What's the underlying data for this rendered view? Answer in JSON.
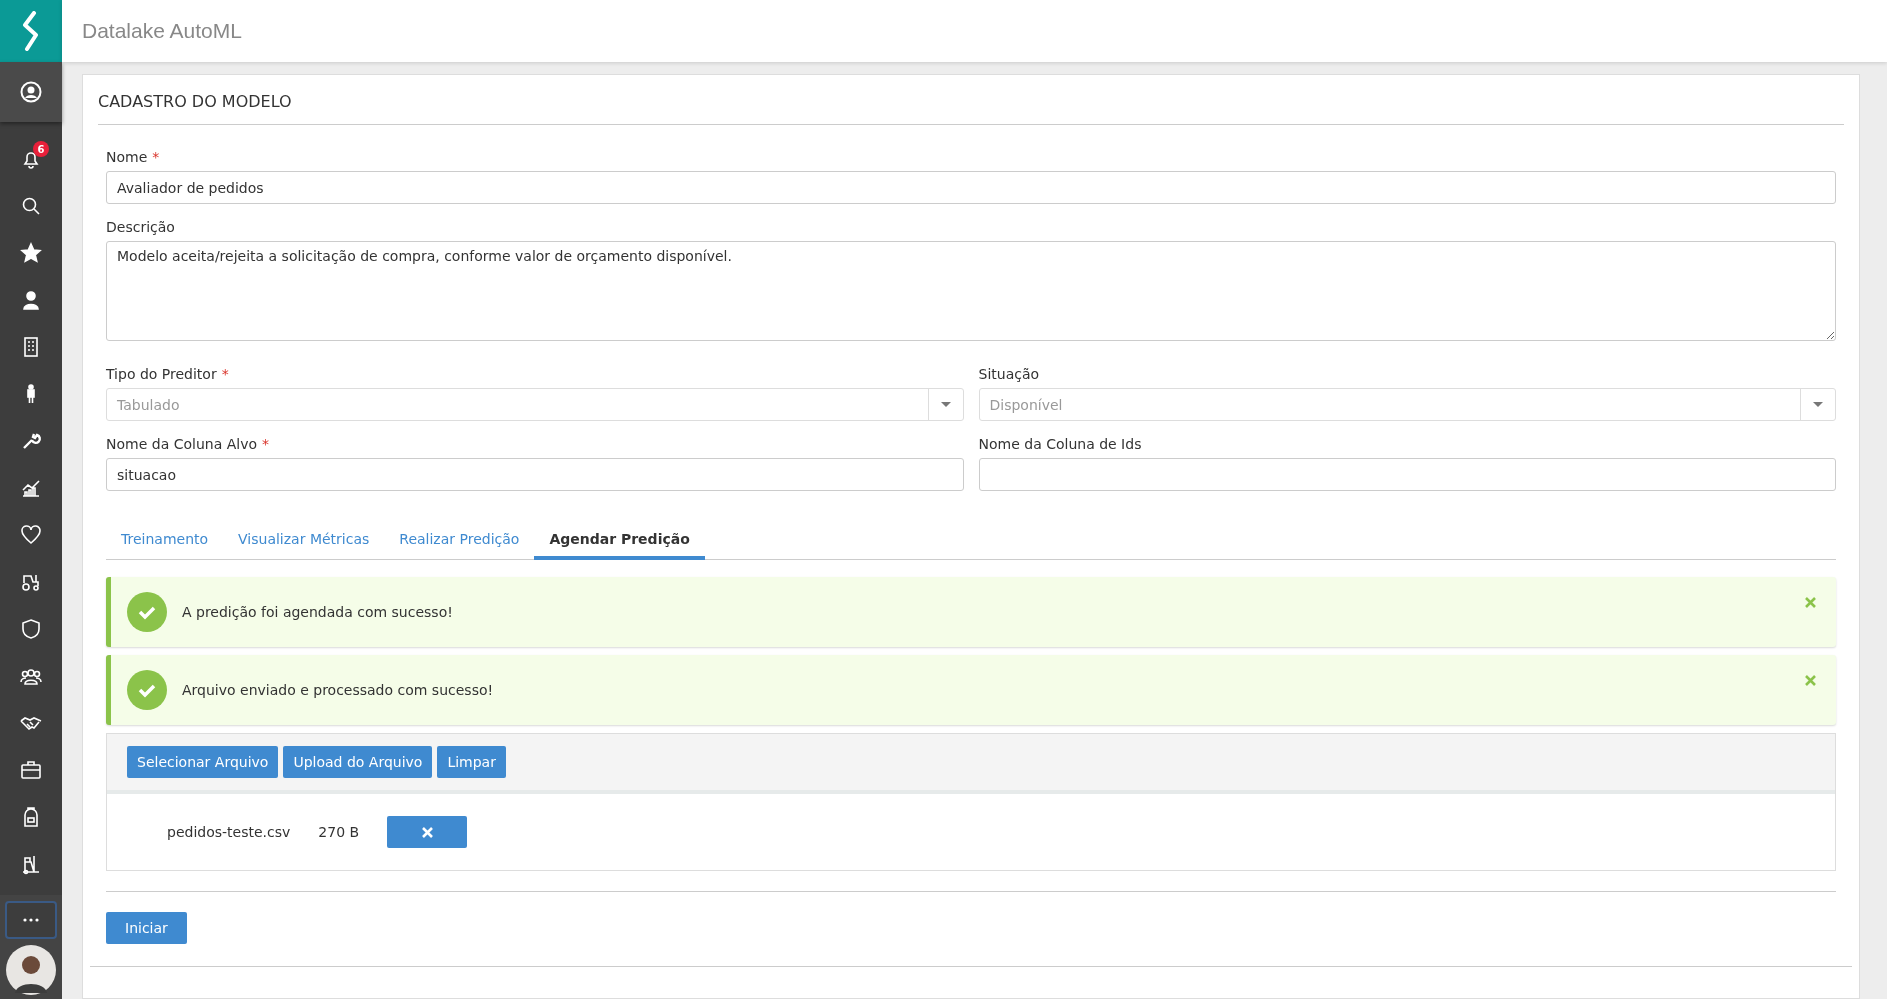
{
  "sidebar": {
    "notification_badge": "6"
  },
  "header": {
    "title": "Datalake AutoML"
  },
  "form": {
    "title": "CADASTRO DO MODELO",
    "name": {
      "label": "Nome",
      "required_mark": "*",
      "value": "Avaliador de pedidos"
    },
    "description": {
      "label": "Descrição",
      "value": "Modelo aceita/rejeita a solicitação de compra, conforme valor de orçamento disponível."
    },
    "fields": [
      {
        "kind": "select",
        "label": "Tipo do Preditor",
        "required_mark": "*",
        "placeholder": "Tabulado"
      },
      {
        "kind": "select",
        "label": "Situação",
        "placeholder": "Disponível"
      },
      {
        "kind": "text",
        "label": "Nome da Coluna Alvo",
        "required_mark": "*",
        "value": "situacao"
      },
      {
        "kind": "text",
        "label": "Nome da Coluna de Ids"
      }
    ]
  },
  "tabs": [
    {
      "label": "Treinamento",
      "selected": false
    },
    {
      "label": "Visualizar Métricas",
      "selected": false
    },
    {
      "label": "Realizar Predição",
      "selected": false
    },
    {
      "label": "Agendar Predição",
      "selected": true
    }
  ],
  "alerts": [
    {
      "message": "A predição foi agendada com sucesso!"
    },
    {
      "message": "Arquivo enviado e processado com sucesso!"
    }
  ],
  "upload": {
    "buttons": [
      "Selecionar Arquivo",
      "Upload do Arquivo",
      "Limpar"
    ],
    "files": [
      {
        "name": "pedidos-teste.csv",
        "size": "270 B"
      }
    ]
  },
  "start_button": "Iniciar"
}
